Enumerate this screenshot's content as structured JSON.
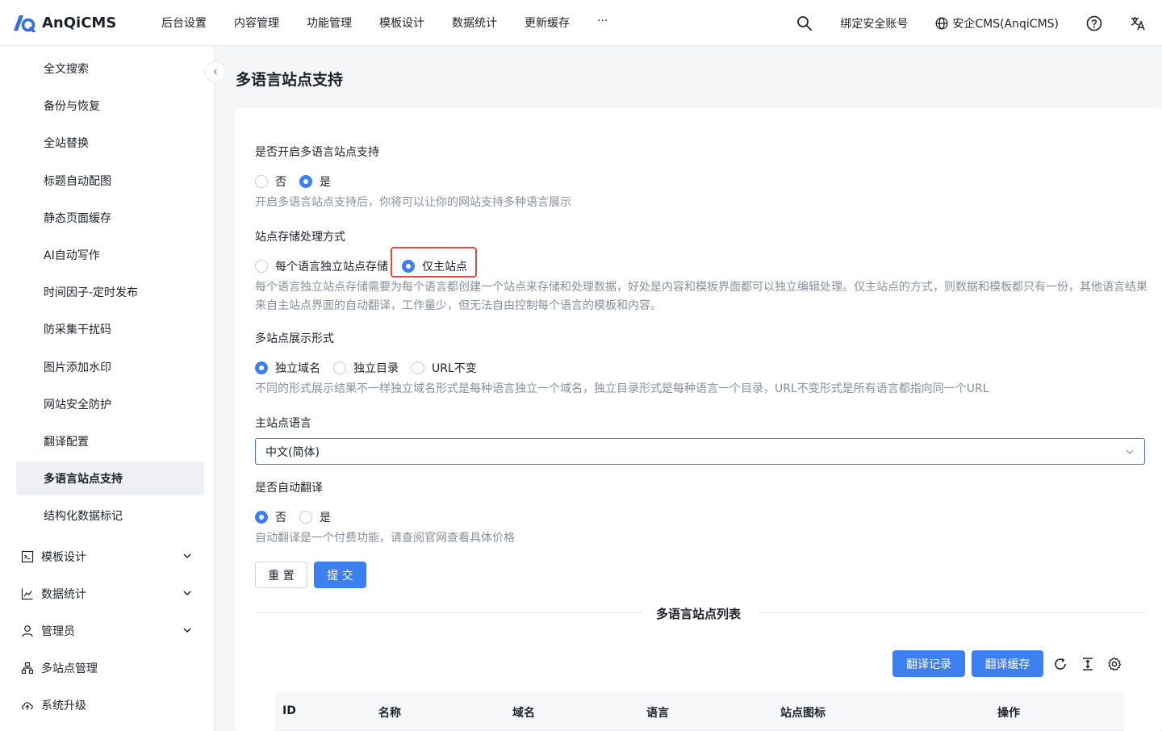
{
  "app": {
    "name": "AnQiCMS"
  },
  "topnav": {
    "items": [
      "后台设置",
      "内容管理",
      "功能管理",
      "模板设计",
      "数据统计",
      "更新缓存",
      "···"
    ],
    "bind_account": "绑定安全账号",
    "site_name": "安企CMS(AnqiCMS)"
  },
  "sidebar": {
    "items": [
      "全文搜索",
      "备份与恢复",
      "全站替换",
      "标题自动配图",
      "静态页面缓存",
      "AI自动写作",
      "时间因子-定时发布",
      "防采集干扰码",
      "图片添加水印",
      "网站安全防护",
      "翻译配置",
      "多语言站点支持",
      "结构化数据标记"
    ],
    "active": "多语言站点支持",
    "groups": [
      "模板设计",
      "数据统计",
      "管理员",
      "多站点管理",
      "系统升级"
    ]
  },
  "page": {
    "title": "多语言站点支持"
  },
  "form": {
    "enable": {
      "label": "是否开启多语言站点支持",
      "options": [
        "否",
        "是"
      ],
      "selected": "是",
      "help": "开启多语言站点支持后，你将可以让你的网站支持多种语言展示"
    },
    "storage": {
      "label": "站点存储处理方式",
      "options": [
        "每个语言独立站点存储",
        "仅主站点"
      ],
      "selected": "仅主站点",
      "help_line1": "每个语言独立站点存储需要为每个语言都创建一个站点来存储和处理数据，好处是内容和模板界面都可以独立编辑处理。仅主站点的方式，则数据和模板都只有一份，其他语言结果",
      "help_line2": "来自主站点界面的自动翻译，工作量少，但无法自由控制每个语言的模板和内容。"
    },
    "display": {
      "label": "多站点展示形式",
      "options": [
        "独立域名",
        "独立目录",
        "URL不变"
      ],
      "selected": "独立域名",
      "help": "不同的形式展示结果不一样独立域名形式是每种语言独立一个域名，独立目录形式是每种语言一个目录，URL不变形式是所有语言都指向同一个URL"
    },
    "main_language": {
      "label": "主站点语言",
      "value": "中文(简体)"
    },
    "auto_translate": {
      "label": "是否自动翻译",
      "options": [
        "否",
        "是"
      ],
      "selected": "否",
      "help": "自动翻译是一个付费功能，请查阅官网查看具体价格"
    },
    "reset_label": "重 置",
    "submit_label": "提 交"
  },
  "site_list": {
    "title": "多语言站点列表",
    "translate_log_label": "翻译记录",
    "translate_cache_label": "翻译缓存",
    "columns": [
      "ID",
      "名称",
      "域名",
      "语言",
      "站点图标",
      "操作"
    ]
  },
  "colors": {
    "primary": "#3c7ff0",
    "highlight_border": "#e34d3f"
  }
}
